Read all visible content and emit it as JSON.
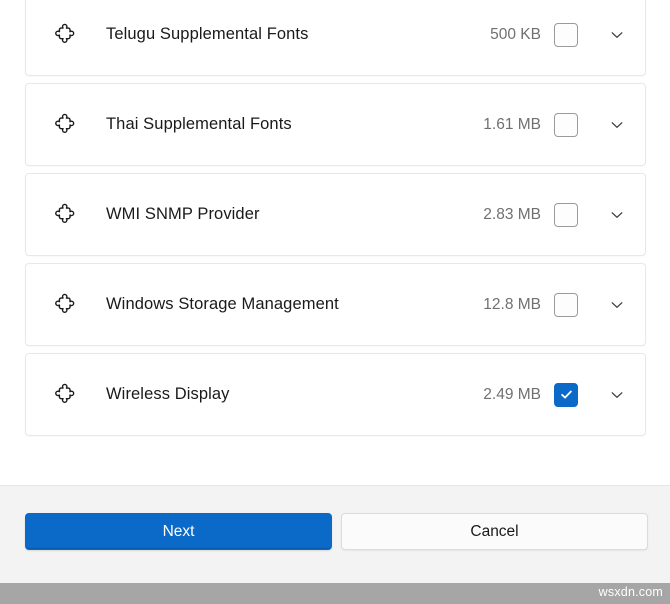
{
  "window": {
    "background_color": "#ffffff",
    "accent_color": "#0b69c7"
  },
  "feature_list": {
    "icon_name": "puzzle-piece-icon",
    "expand_icon_name": "chevron-down-icon",
    "rows": [
      {
        "label": "Telugu Supplemental Fonts",
        "size": "500 KB",
        "checked": false
      },
      {
        "label": "Thai Supplemental Fonts",
        "size": "1.61 MB",
        "checked": false
      },
      {
        "label": "WMI SNMP Provider",
        "size": "2.83 MB",
        "checked": false
      },
      {
        "label": "Windows Storage Management",
        "size": "12.8 MB",
        "checked": false
      },
      {
        "label": "Wireless Display",
        "size": "2.49 MB",
        "checked": true
      }
    ]
  },
  "footer": {
    "next_label": "Next",
    "cancel_label": "Cancel"
  },
  "watermark": {
    "text": "wsxdn.com"
  }
}
